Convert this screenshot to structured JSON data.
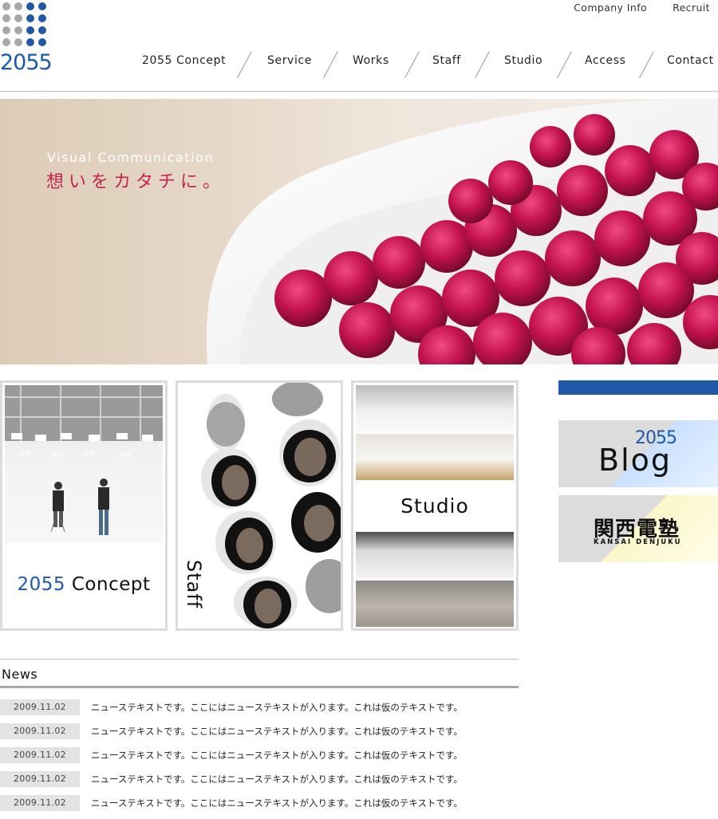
{
  "logo": {
    "text": "2055"
  },
  "utility_nav": [
    {
      "label": "Company Info"
    },
    {
      "label": "Recruit"
    }
  ],
  "main_nav": [
    {
      "label": "2055 Concept"
    },
    {
      "label": "Service"
    },
    {
      "label": "Works"
    },
    {
      "label": "Staff"
    },
    {
      "label": "Studio"
    },
    {
      "label": "Access"
    },
    {
      "label": "Contact"
    }
  ],
  "hero": {
    "tagline_en": "Visual Communication",
    "tagline_jp": "想いをカタチに。"
  },
  "panels": {
    "concept": {
      "label_number": "2055",
      "label_word": "Concept"
    },
    "staff": {
      "label": "Staff"
    },
    "studio": {
      "label": "Studio"
    }
  },
  "sidebar": {
    "blog": {
      "number": "2055",
      "label": "Blog"
    },
    "kansai": {
      "label_jp": "関西電塾",
      "label_en": "KANSAI DENJUKU"
    }
  },
  "news": {
    "title": "News",
    "items": [
      {
        "date": "2009.11.02",
        "text": "ニューステキストです。ここにはニューステキストが入ります。これは仮のテキストです。"
      },
      {
        "date": "2009.11.02",
        "text": "ニューステキストです。ここにはニューステキストが入ります。これは仮のテキストです。"
      },
      {
        "date": "2009.11.02",
        "text": "ニューステキストです。ここにはニューステキストが入ります。これは仮のテキストです。"
      },
      {
        "date": "2009.11.02",
        "text": "ニューステキストです。ここにはニューステキストが入ります。これは仮のテキストです。"
      },
      {
        "date": "2009.11.02",
        "text": "ニューステキストです。ここにはニューステキストが入ります。これは仮のテキストです。"
      }
    ]
  },
  "colors": {
    "brand_blue": "#1f58a6",
    "accent_red": "#c4244f"
  }
}
